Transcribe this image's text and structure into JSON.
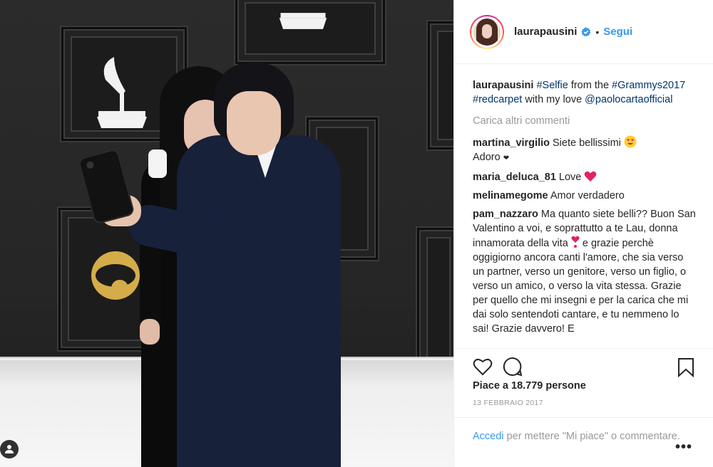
{
  "post": {
    "username": "laurapausini",
    "follow_label": "Segui",
    "separator": "•",
    "caption": {
      "user": "laurapausini",
      "parts": [
        {
          "text": "#Selfie",
          "tag": true
        },
        {
          "text": " from the ",
          "tag": false
        },
        {
          "text": "#Grammys2017",
          "tag": true
        },
        {
          "text": " ",
          "tag": false
        },
        {
          "text": "#redcarpet",
          "tag": true
        },
        {
          "text": " with my love ",
          "tag": false
        },
        {
          "text": "@paolocartaofficial",
          "tag": true
        }
      ]
    },
    "load_more_label": "Carica altri commenti",
    "comments": [
      {
        "user": "martina_virgilio",
        "text": "Siete bellissimi",
        "emoji": "heart-eyes-emoji",
        "line2": "Adoro",
        "line2_emoji": "small-heart-emoji"
      },
      {
        "user": "maria_deluca_81",
        "text": "Love",
        "emoji": "red-heart-emoji"
      },
      {
        "user": "melinamegome",
        "text": "Amor verdadero"
      },
      {
        "user": "pam_nazzaro",
        "text_before_emoji": "Ma quanto siete belli?? Buon San Valentino a voi, e soprattutto a te Lau, donna innamorata della vita",
        "emoji": "heart-exclamation-emoji",
        "text_after_emoji": " e grazie perchè oggigiorno ancora canti l'amore, che sia verso un partner, verso un genitore, verso un figlio, o verso un amico, o verso la vita stessa. Grazie per quello che mi insegni e per la carica che mi dai solo sentendoti cantare, e tu nemmeno lo sai! Grazie davvero! E"
      }
    ],
    "likes_label": "Piace a 18.779 persone",
    "date": "13 FEBBRAIO 2017",
    "footer": {
      "login_label": "Accedi",
      "text": " per mettere \"Mi piace\" o commentare."
    },
    "more_label": "•••"
  },
  "colors": {
    "link": "#3897f0",
    "tag": "#003569",
    "muted": "#999999",
    "text": "#262626"
  },
  "icons": [
    "verified-badge-icon",
    "heart-icon",
    "comment-icon",
    "bookmark-icon",
    "user-tag-icon",
    "more-options-icon"
  ]
}
